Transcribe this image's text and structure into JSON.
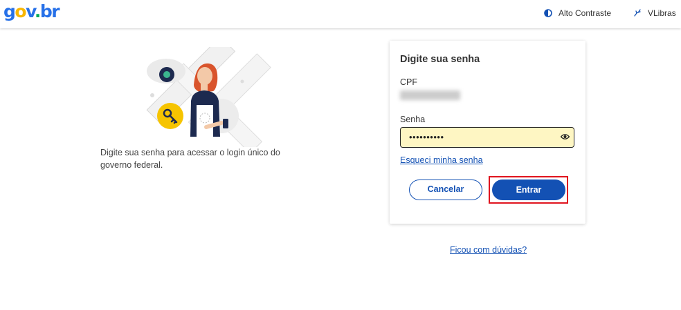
{
  "header": {
    "logo": {
      "g": "g",
      "o": "o",
      "v": "v",
      "dot": ".",
      "br": "br"
    },
    "contrast_label": "Alto Contraste",
    "vlibras_label": "VLibras"
  },
  "left": {
    "description": "Digite sua senha para acessar o login único do governo federal."
  },
  "card": {
    "title": "Digite sua senha",
    "cpf_label": "CPF",
    "cpf_value": "",
    "senha_label": "Senha",
    "senha_value": "••••••••••",
    "forgot_link": "Esqueci minha senha",
    "cancel_button": "Cancelar",
    "enter_button": "Entrar"
  },
  "footer": {
    "doubts_link": "Ficou com dúvidas?"
  },
  "colors": {
    "primary": "#1351b4",
    "input_bg": "#fef6c3",
    "highlight": "#e0141e"
  }
}
